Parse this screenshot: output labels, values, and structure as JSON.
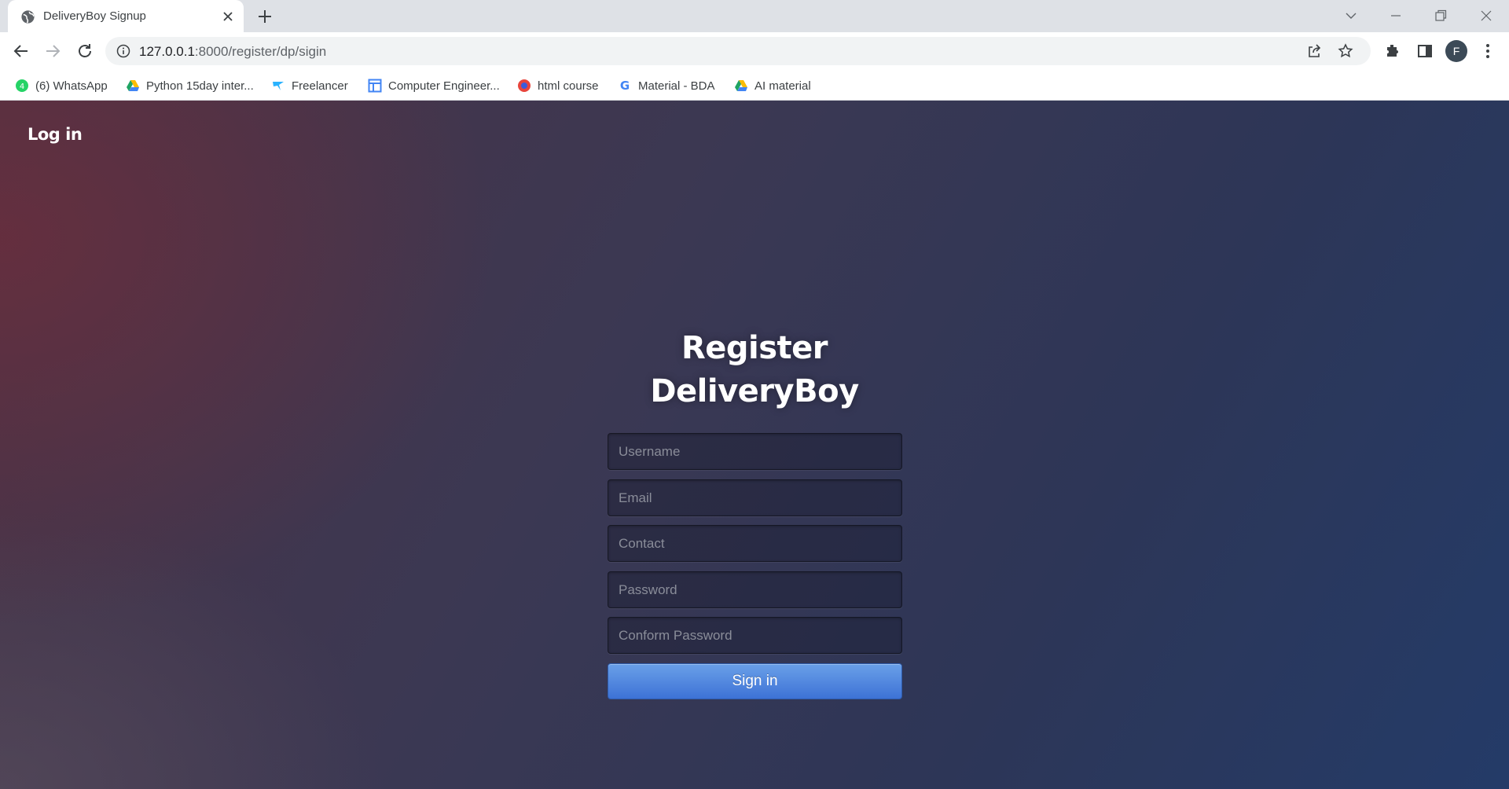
{
  "browser": {
    "tab": {
      "title": "DeliveryBoy Signup"
    },
    "url": {
      "host": "127.0.0.1",
      "rest": ":8000/register/dp/sigin"
    },
    "profile_initial": "F",
    "bookmarks": [
      {
        "label": "(6) WhatsApp",
        "icon": "whatsapp-icon"
      },
      {
        "label": "Python 15day inter...",
        "icon": "google-drive-icon"
      },
      {
        "label": "Freelancer",
        "icon": "freelancer-icon"
      },
      {
        "label": "Computer Engineer...",
        "icon": "layout-icon"
      },
      {
        "label": "html course",
        "icon": "course-icon"
      },
      {
        "label": "Material - BDA",
        "icon": "google-icon"
      },
      {
        "label": "AI material",
        "icon": "google-drive-icon"
      }
    ]
  },
  "page": {
    "login_link": "Log in",
    "title_line1": "Register",
    "title_line2": "DeliveryBoy",
    "form": {
      "username_placeholder": "Username",
      "email_placeholder": "Email",
      "contact_placeholder": "Contact",
      "password_placeholder": "Password",
      "confirm_placeholder": "Conform Password",
      "submit_label": "Sign in"
    }
  },
  "colors": {
    "submit_button": "#4a80de",
    "background_left": "#5a2f42",
    "background_right": "#243b68"
  }
}
